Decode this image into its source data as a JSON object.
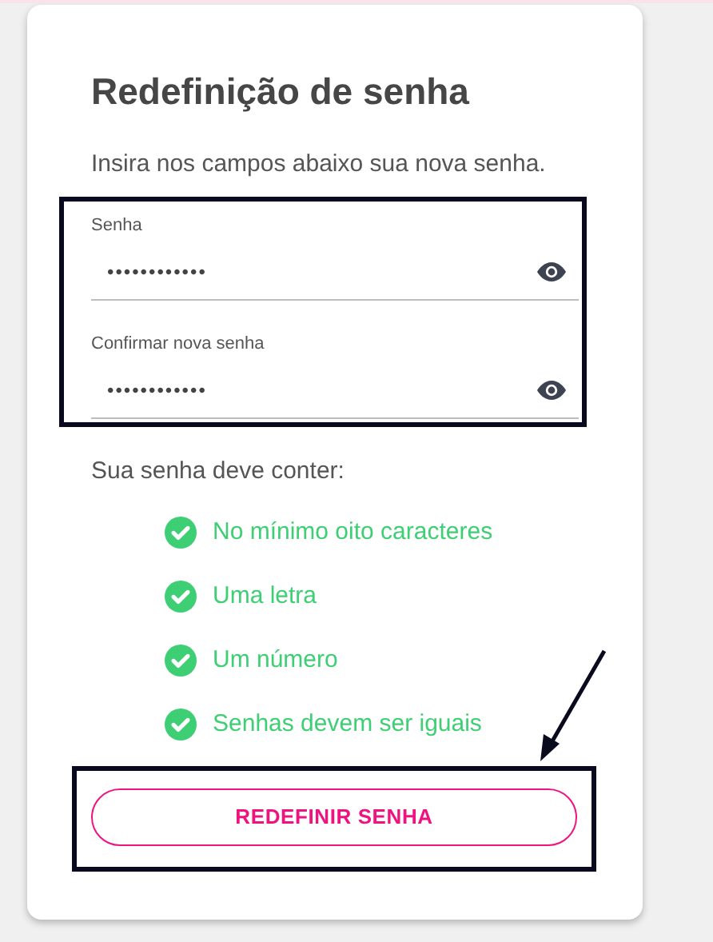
{
  "title": "Redefinição de senha",
  "subtitle": "Insira nos campos abaixo sua nova senha.",
  "fields": [
    {
      "label": "Senha",
      "value": "••••••••••••"
    },
    {
      "label": "Confirmar nova senha",
      "value": "••••••••••••"
    }
  ],
  "requirements_heading": "Sua senha deve conter:",
  "requirements": [
    {
      "text": "No mínimo oito caracteres",
      "met": true
    },
    {
      "text": "Uma letra",
      "met": true
    },
    {
      "text": "Um número",
      "met": true
    },
    {
      "text": "Senhas devem ser iguais",
      "met": true
    }
  ],
  "button": "REDEFINIR SENHA"
}
